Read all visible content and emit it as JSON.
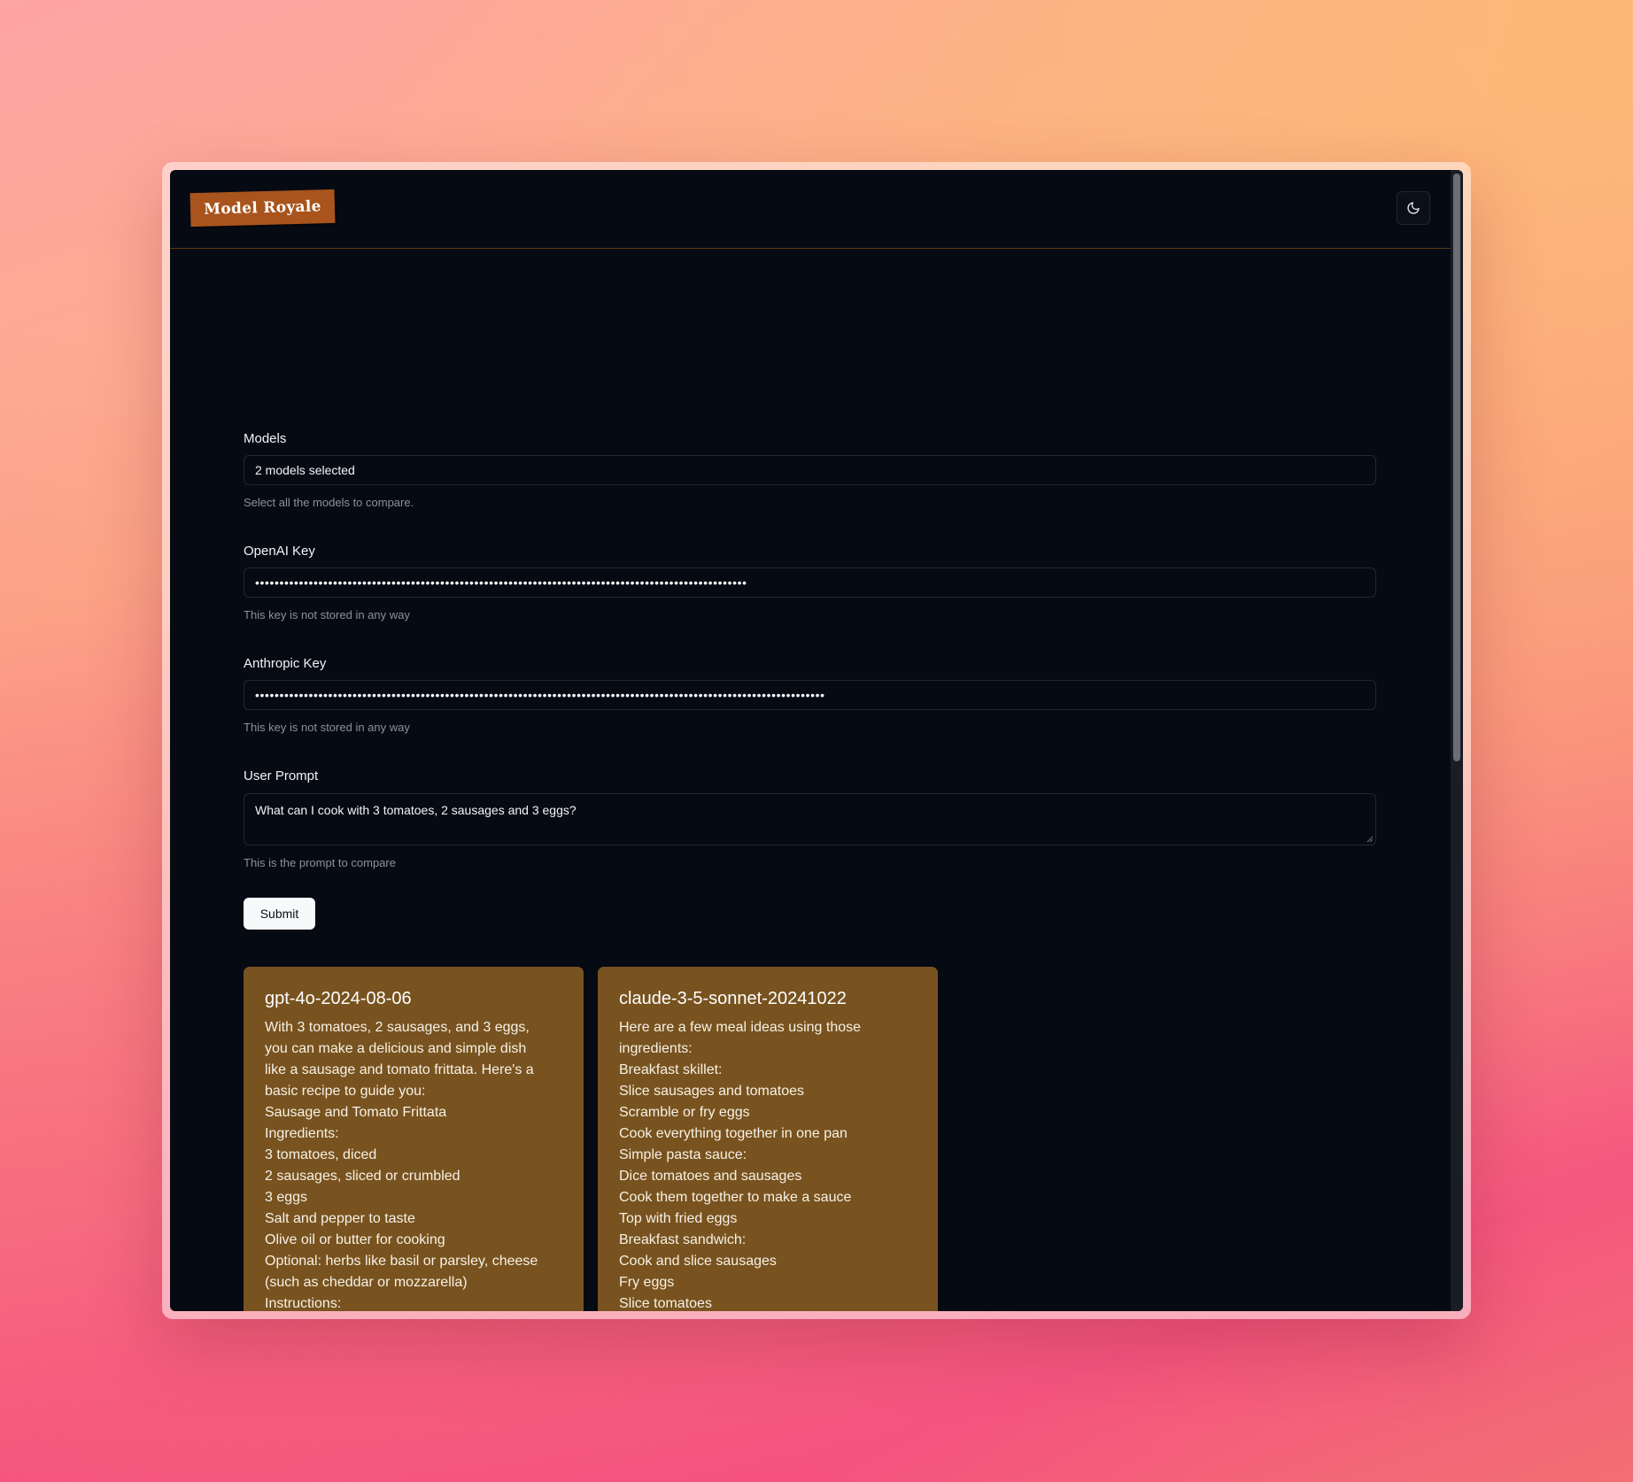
{
  "app": {
    "logo_text": "Model Royale",
    "accent_color": "#78531f",
    "logo_color": "#a8541c"
  },
  "theme_toggle": {
    "icon": "moon-icon"
  },
  "form": {
    "models": {
      "label": "Models",
      "value": "2 models selected",
      "hint": "Select all the models to compare."
    },
    "openai_key": {
      "label": "OpenAI Key",
      "value": "•••••••••••••••••••••••••••••••••••••••••••••••••••••••••••••••••••••••••••••••••••••••••••••••••••••",
      "hint": "This key is not stored in any way"
    },
    "anthropic_key": {
      "label": "Anthropic Key",
      "value": "•••••••••••••••••••••••••••••••••••••••••••••••••••••••••••••••••••••••••••••••••••••••••••••••••••••••••••••••••••••",
      "hint": "This key is not stored in any way"
    },
    "user_prompt": {
      "label": "User Prompt",
      "value": "What can I cook with 3 tomatoes, 2 sausages and 3 eggs?",
      "hint": "This is the prompt to compare"
    },
    "submit_label": "Submit"
  },
  "results": [
    {
      "model": "gpt-4o-2024-08-06",
      "lines": [
        "With 3 tomatoes, 2 sausages, and 3 eggs,",
        "you can make a delicious and simple dish",
        "like a sausage and tomato frittata. Here's a",
        "basic recipe to guide you:",
        "Sausage and Tomato Frittata",
        "Ingredients:",
        "3 tomatoes, diced",
        "2 sausages, sliced or crumbled",
        "3 eggs",
        "Salt and pepper to taste",
        "Olive oil or butter for cooking",
        "Optional: herbs like basil or parsley, cheese",
        "(such as cheddar or mozzarella)",
        "Instructions:"
      ]
    },
    {
      "model": "claude-3-5-sonnet-20241022",
      "lines": [
        "Here are a few meal ideas using those",
        "ingredients:",
        "Breakfast skillet:",
        "Slice sausages and tomatoes",
        "Scramble or fry eggs",
        "Cook everything together in one pan",
        "Simple pasta sauce:",
        "Dice tomatoes and sausages",
        "Cook them together to make a sauce",
        "Top with fried eggs",
        "Breakfast sandwich:",
        "Cook and slice sausages",
        "Fry eggs",
        "Slice tomatoes"
      ]
    }
  ]
}
